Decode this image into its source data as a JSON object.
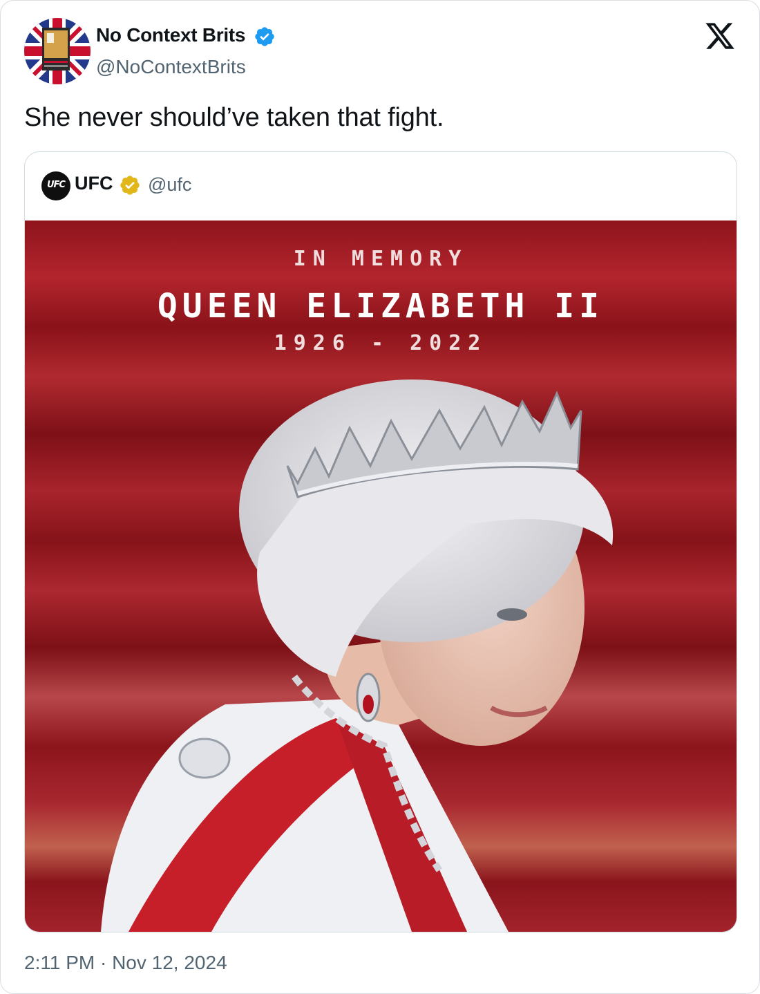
{
  "tweet": {
    "author_name": "No Context Brits",
    "author_handle": "@NoContextBrits",
    "text": "She never should’ve taken that fight.",
    "timestamp": "2:11 PM · Nov 12, 2024",
    "verified_color": "#1d9bf0"
  },
  "quoted": {
    "author_name": "UFC",
    "author_handle": "@ufc",
    "avatar_text": "UFC",
    "verified_color": "#e2b719",
    "media": {
      "line1": "IN MEMORY",
      "line2": "QUEEN ELIZABETH II",
      "line3": "1926 - 2022",
      "background_color": "#a11e26"
    }
  },
  "icons": {
    "platform": "x-logo-icon",
    "verified": "verified-badge-icon"
  }
}
